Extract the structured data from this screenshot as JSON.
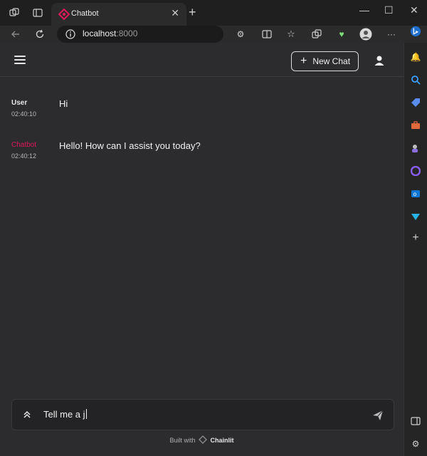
{
  "browser": {
    "tab_title": "Chatbot",
    "url_host": "localhost",
    "url_port": ":8000"
  },
  "app": {
    "new_chat_label": "New Chat",
    "messages": [
      {
        "author": "User",
        "time": "02:40:10",
        "content": "Hi"
      },
      {
        "author": "Chatbot",
        "time": "02:40:12",
        "content": "Hello! How can I assist you today?"
      }
    ],
    "input_value": "Tell me a j",
    "footer_prefix": "Built with",
    "footer_brand": "Chainlit"
  },
  "colors": {
    "accent": "#e0185a",
    "background": "#2c2b2d",
    "header_border": "#3a393b"
  },
  "icons": [
    "workspaces-icon",
    "tab-actions-icon",
    "chainlit-favicon",
    "close-tab-icon",
    "new-tab-icon",
    "minimize-icon",
    "maximize-icon",
    "window-close-icon",
    "back-icon",
    "refresh-icon",
    "info-icon",
    "read-aloud-icon",
    "favorite-star-icon",
    "extensions-icon",
    "split-screen-icon",
    "favorites-icon",
    "collections-icon",
    "health-icon",
    "profile-avatar",
    "more-icon",
    "bing-icon",
    "menu-icon",
    "user-icon",
    "expand-icon",
    "send-icon"
  ]
}
